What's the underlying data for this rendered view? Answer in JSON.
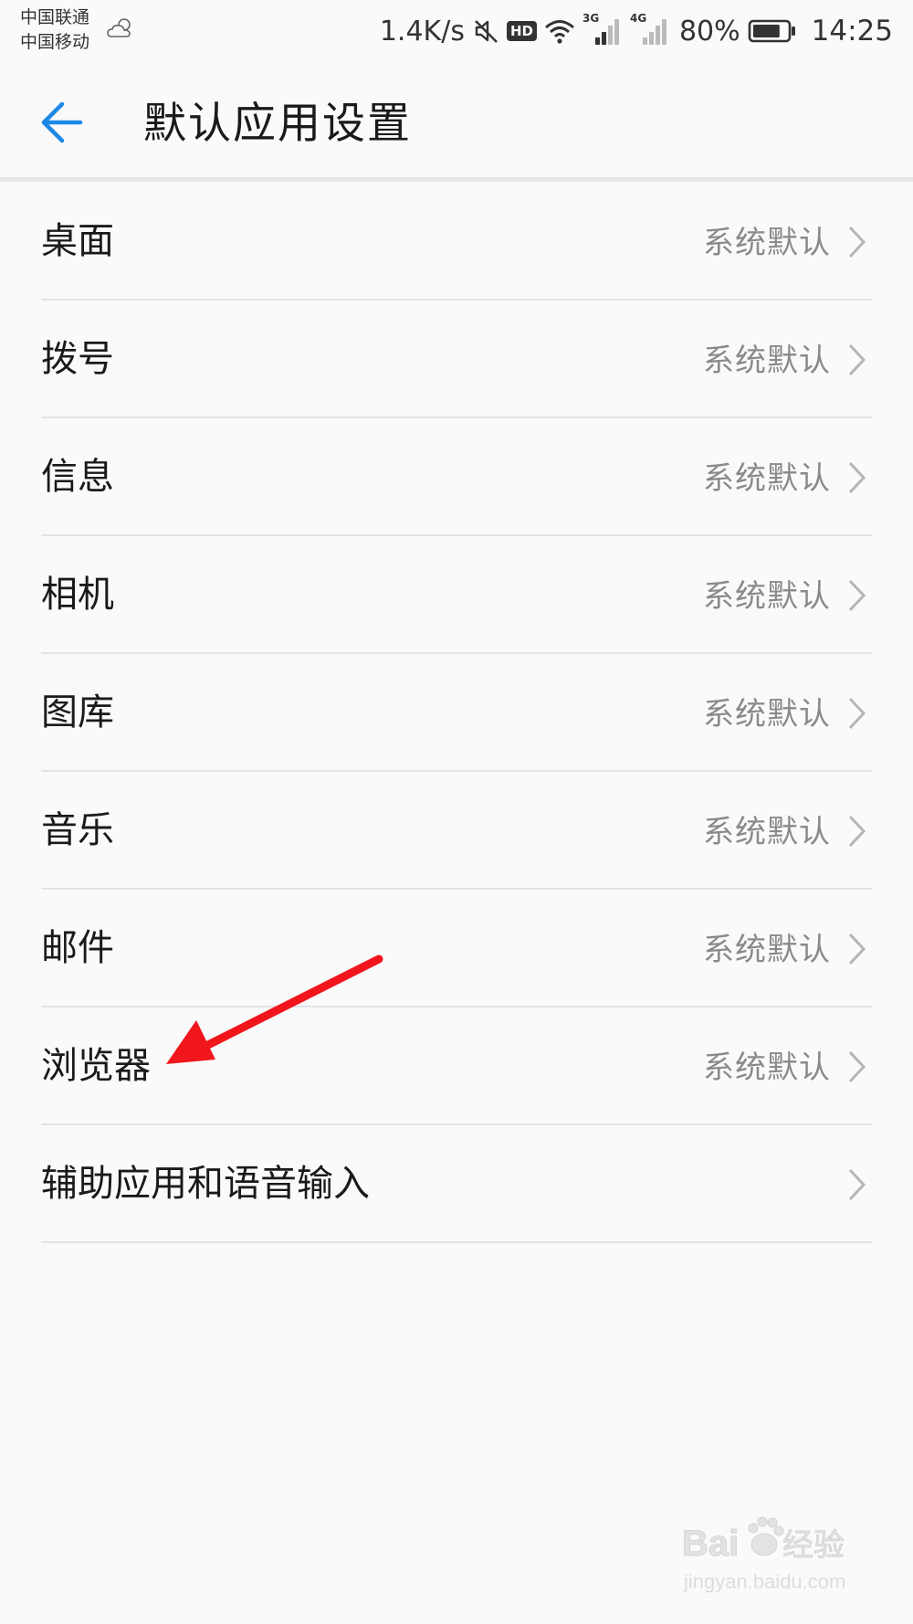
{
  "status_bar": {
    "carrier_1": "中国联通",
    "carrier_2": "中国移动",
    "weather_icon": "cloudy-sun-icon",
    "net_speed": "1.4K/s",
    "hd_badge": "HD",
    "signal_1_label": "3G",
    "signal_2_label": "4G",
    "battery_percent": "80%",
    "battery_level": 0.8,
    "time": "14:25"
  },
  "header": {
    "back_icon": "arrow-left-icon",
    "title": "默认应用设置",
    "accent_color": "#1e88e5"
  },
  "settings": {
    "items": [
      {
        "label": "桌面",
        "value": "系统默认"
      },
      {
        "label": "拨号",
        "value": "系统默认"
      },
      {
        "label": "信息",
        "value": "系统默认"
      },
      {
        "label": "相机",
        "value": "系统默认"
      },
      {
        "label": "图库",
        "value": "系统默认"
      },
      {
        "label": "音乐",
        "value": "系统默认"
      },
      {
        "label": "邮件",
        "value": "系统默认"
      },
      {
        "label": "浏览器",
        "value": "系统默认"
      },
      {
        "label": "辅助应用和语音输入",
        "value": ""
      }
    ]
  },
  "annotation": {
    "arrow_color": "#f0161c",
    "points_to": "浏览器"
  },
  "watermark": {
    "brand": "Bai",
    "brand_suffix": "经验",
    "url": "jingyan.baidu.com"
  }
}
